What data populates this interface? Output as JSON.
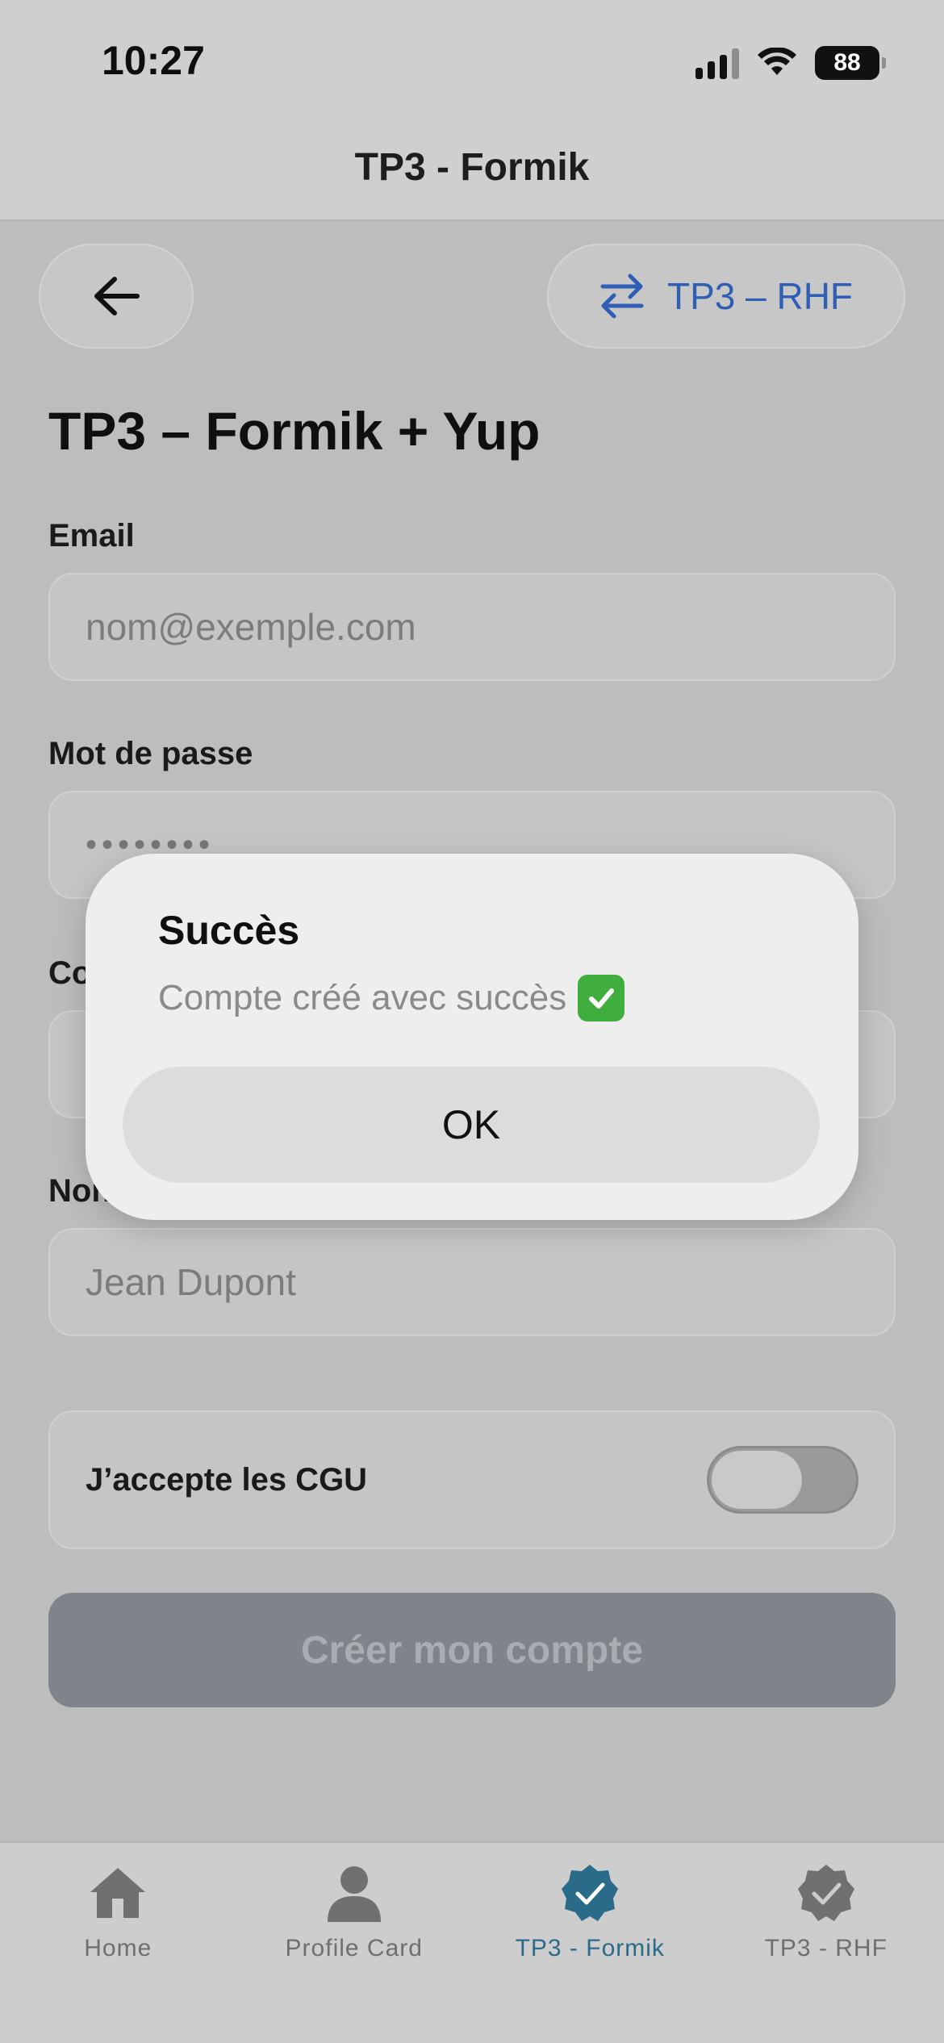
{
  "status_bar": {
    "time": "10:27",
    "battery": "88"
  },
  "header": {
    "title": "TP3 - Formik"
  },
  "top_buttons": {
    "back_icon": "arrow-left-icon",
    "switch_label": "TP3 – RHF",
    "switch_icon": "swap-arrows-icon"
  },
  "form": {
    "title": "TP3 – Formik + Yup",
    "email_label": "Email",
    "email_placeholder": "nom@exemple.com",
    "password_label": "Mot de passe",
    "password_value": "••••••••",
    "confirm_label_fragment": "Co",
    "name_label_fragment": "Non",
    "name_placeholder": "Jean Dupont",
    "cgu_label": "J’accepte les CGU",
    "cgu_checked": false,
    "submit_label": "Créer mon compte"
  },
  "modal": {
    "title": "Succès",
    "message": "Compte créé avec succès",
    "message_icon": "check-mark-button-icon",
    "ok_label": "OK"
  },
  "tabbar": {
    "items": [
      {
        "label": "Home",
        "icon": "home-icon",
        "active": false
      },
      {
        "label": "Profile Card",
        "icon": "person-icon",
        "active": false
      },
      {
        "label": "TP3 - Formik",
        "icon": "verified-badge-icon",
        "active": true
      },
      {
        "label": "TP3 - RHF",
        "icon": "verified-badge-icon",
        "active": false
      }
    ]
  },
  "colors": {
    "accent": "#2b6b8a",
    "link": "#2f5fb4",
    "submit_disabled": "#7f838a"
  }
}
